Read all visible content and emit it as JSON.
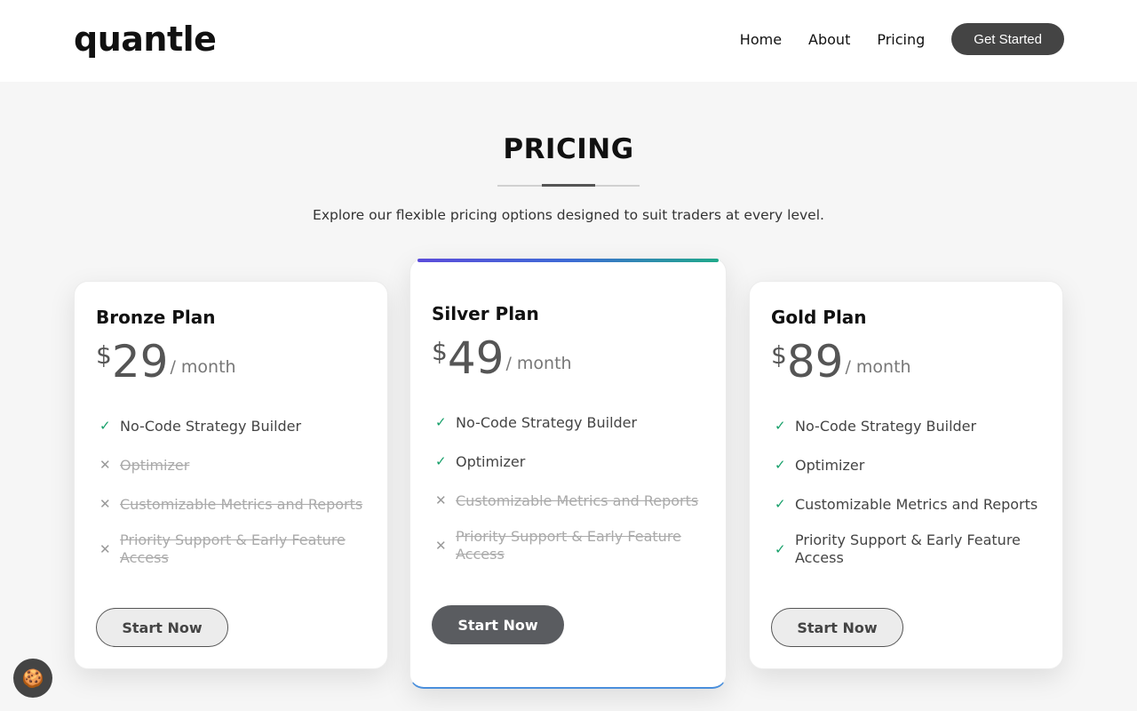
{
  "header": {
    "logo": "quantle",
    "nav": [
      "Home",
      "About",
      "Pricing"
    ],
    "cta": "Get Started"
  },
  "section": {
    "title": "PRICING",
    "subtitle": "Explore our flexible pricing options designed to suit traders at every level."
  },
  "plans": [
    {
      "name": "Bronze Plan",
      "currency": "$",
      "amount": "29",
      "period": "/ month",
      "features": [
        {
          "label": "No-Code Strategy Builder",
          "included": true
        },
        {
          "label": "Optimizer",
          "included": false
        },
        {
          "label": "Customizable Metrics and Reports",
          "included": false
        },
        {
          "label": "Priority Support & Early Feature Access",
          "included": false
        }
      ],
      "button": "Start Now"
    },
    {
      "name": "Silver Plan",
      "currency": "$",
      "amount": "49",
      "period": "/ month",
      "features": [
        {
          "label": "No-Code Strategy Builder",
          "included": true
        },
        {
          "label": "Optimizer",
          "included": true
        },
        {
          "label": "Customizable Metrics and Reports",
          "included": false
        },
        {
          "label": "Priority Support & Early Feature Access",
          "included": false
        }
      ],
      "button": "Start Now"
    },
    {
      "name": "Gold Plan",
      "currency": "$",
      "amount": "89",
      "period": "/ month",
      "features": [
        {
          "label": "No-Code Strategy Builder",
          "included": true
        },
        {
          "label": "Optimizer",
          "included": true
        },
        {
          "label": "Customizable Metrics and Reports",
          "included": true
        },
        {
          "label": "Priority Support & Early Feature Access",
          "included": true
        }
      ],
      "button": "Start Now"
    }
  ],
  "icons": {
    "check": "check-icon",
    "cross": "cross-icon",
    "cookie": "cookie-icon"
  },
  "colors": {
    "accent": "#444444",
    "check": "#17a06a",
    "highlight_gradient": [
      "#5b4cdb",
      "#1fa98a"
    ]
  }
}
